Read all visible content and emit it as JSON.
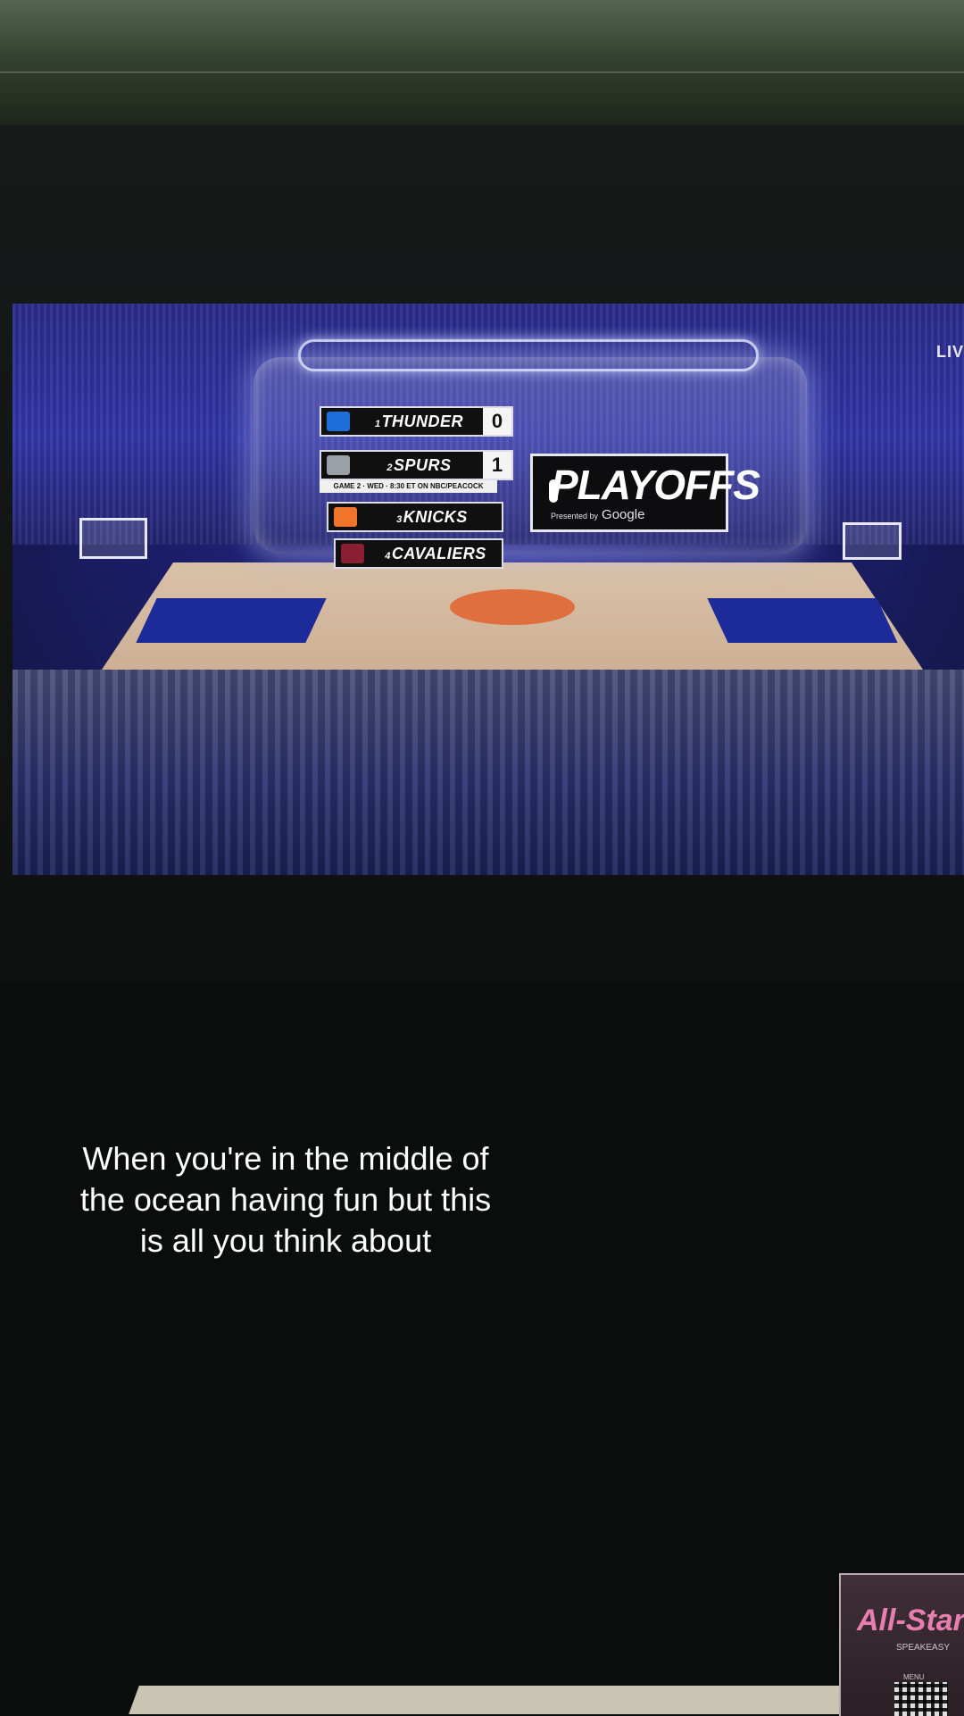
{
  "scene": {
    "colors": {
      "wall": "#3a4634",
      "screen_glow": "#2a2d8a",
      "court": "#d2b79d",
      "caption": "#ffffff"
    }
  },
  "broadcast": {
    "live_label": "LIV",
    "standings": [
      {
        "seed": "1",
        "team": "THUNDER",
        "score": "0",
        "color": "#1e6fd9",
        "icon": "thunder-logo-icon"
      },
      {
        "seed": "2",
        "team": "SPURS",
        "score": "1",
        "color": "#9aa0a6",
        "icon": "spurs-logo-icon"
      },
      {
        "seed": "3",
        "team": "KNICKS",
        "score": "",
        "color": "#f0742a",
        "icon": "knicks-logo-icon"
      },
      {
        "seed": "4",
        "team": "CAVALIERS",
        "score": "",
        "color": "#8a1e33",
        "icon": "cavaliers-logo-icon"
      }
    ],
    "game_note": "GAME 2 · WED · 8:30 ET ON NBC/PEACOCK",
    "playoffs_title": "PLAYOFFS",
    "presented_by": "Presented by",
    "sponsor": "Google"
  },
  "caption": {
    "line1": "When you're in the middle of",
    "line2": "the ocean having fun but this",
    "line3": "is all you think about"
  },
  "card": {
    "title": "All-Star",
    "subtitle": "SPEAKEASY",
    "label": "MENU"
  }
}
